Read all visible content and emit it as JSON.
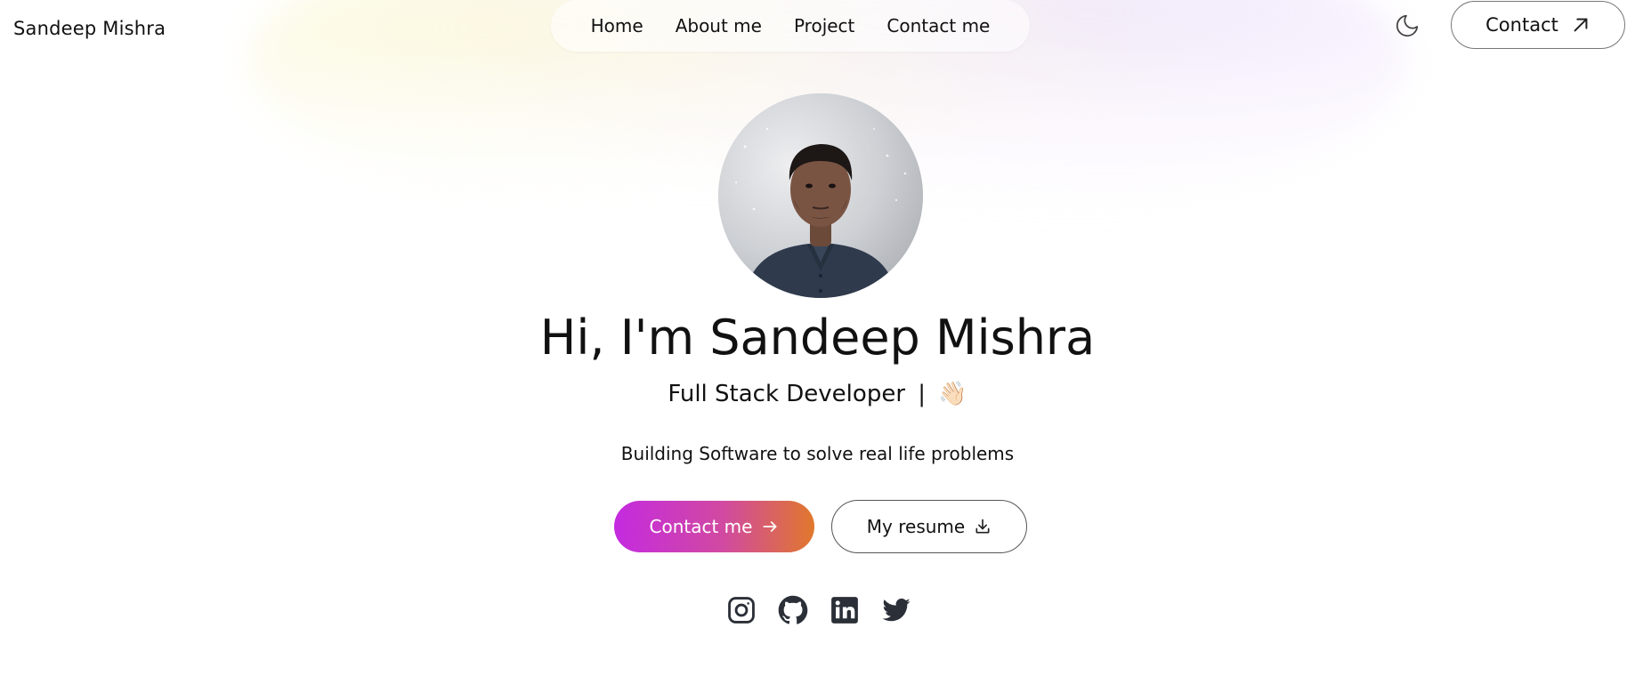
{
  "header": {
    "brand": "Sandeep Mishra",
    "nav": [
      {
        "label": "Home"
      },
      {
        "label": "About me"
      },
      {
        "label": "Project"
      },
      {
        "label": "Contact me"
      }
    ],
    "theme_toggle_icon": "moon-icon",
    "contact_button": {
      "label": "Contact",
      "icon": "arrow-up-right-icon"
    }
  },
  "hero": {
    "avatar_icon": "profile-photo",
    "title": "Hi, I'm Sandeep Mishra",
    "subtitle": "Full Stack Developer",
    "subtitle_separator": "|",
    "subtitle_emoji": "👋🏻",
    "tagline": "Building Software to solve real life problems",
    "primary_button": {
      "label": "Contact me",
      "icon": "arrow-right-icon"
    },
    "secondary_button": {
      "label": "My resume",
      "icon": "download-icon"
    }
  },
  "socials": [
    {
      "name": "instagram-icon"
    },
    {
      "name": "github-icon"
    },
    {
      "name": "linkedin-icon"
    },
    {
      "name": "twitter-icon"
    }
  ],
  "colors": {
    "primary_gradient_start": "#c42ae0",
    "primary_gradient_end": "#e0782c",
    "text": "#111111",
    "icon": "#2b2f38"
  }
}
